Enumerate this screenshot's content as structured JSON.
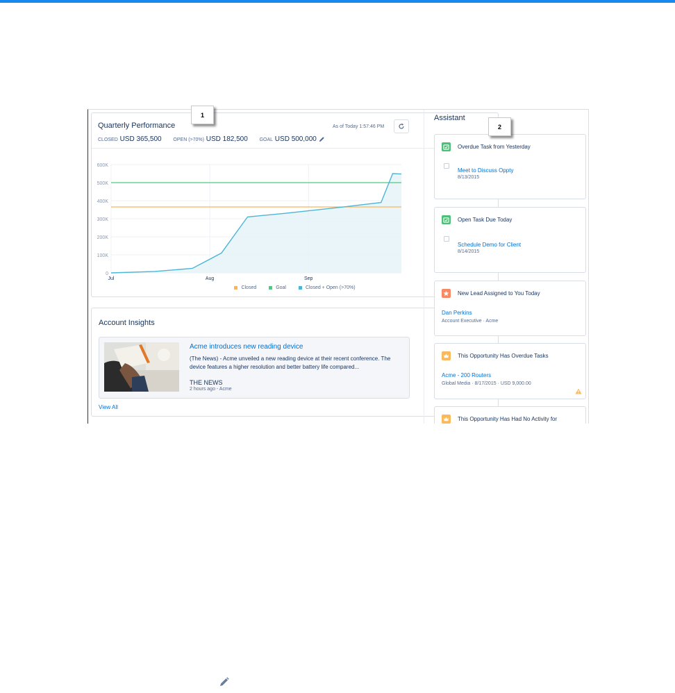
{
  "quarterly": {
    "title": "Quarterly Performance",
    "as_of": "As of Today 1:57:46 PM",
    "closed_label": "CLOSED",
    "closed_value": "USD 365,500",
    "open_label": "OPEN (>70%)",
    "open_value": "USD 182,500",
    "goal_label": "GOAL",
    "goal_value": "USD 500,000"
  },
  "callouts": {
    "one": "1",
    "two": "2"
  },
  "chart_data": {
    "type": "line",
    "x_labels": [
      "Jul",
      "Aug",
      "Sep"
    ],
    "y_ticks": [
      "0",
      "100K",
      "200K",
      "300K",
      "400K",
      "500K",
      "600K"
    ],
    "ylim": [
      0,
      600000
    ],
    "series": [
      {
        "name": "Closed",
        "color": "#f9b55b",
        "type": "line",
        "values": [
          365500
        ]
      },
      {
        "name": "Goal",
        "color": "#4bca81",
        "type": "line",
        "values": [
          500000
        ]
      },
      {
        "name": "Closed + Open (>70%)",
        "color": "#4bb5d6",
        "type": "area",
        "x": [
          0,
          0.15,
          0.28,
          0.38,
          0.47,
          0.6,
          0.8,
          0.93,
          0.97,
          1.0
        ],
        "values": [
          0,
          8000,
          25000,
          110000,
          310000,
          330000,
          365000,
          390000,
          550000,
          548000
        ]
      }
    ],
    "grid": true,
    "legend": "bottom"
  },
  "insights": {
    "title": "Account Insights",
    "news_title": "Acme introduces new reading device",
    "news_body": "(The News) - Acme unveiled a new reading device at their recent conference. The device features a higher resolution and better battery life compared...",
    "news_source": "THE NEWS",
    "news_time": "2 hours ago - Acme",
    "view_all": "View All"
  },
  "assistant": {
    "title": "Assistant",
    "cards": [
      {
        "heading": "Overdue Task from Yesterday",
        "link": "Meet to Discuss Oppty",
        "sub": "8/13/2015",
        "icon": "task-icon",
        "color": "#4bc076"
      },
      {
        "heading": "Open Task Due Today",
        "link": "Schedule Demo for Client",
        "sub": "8/14/2015",
        "icon": "task-icon",
        "color": "#4bc076"
      },
      {
        "heading": "New Lead Assigned to You Today",
        "link": "Dan Perkins",
        "sub": "Account Executive · Acme",
        "icon": "lead-icon",
        "color": "#f88962"
      },
      {
        "heading": "This Opportunity Has Overdue Tasks",
        "link": "Acme - 200 Routers",
        "sub": "Global Media · 8/17/2015 · USD 9,000.00",
        "icon": "opportunity-icon",
        "color": "#fcb95b"
      },
      {
        "heading": "This Opportunity Has Had No Activity for",
        "icon": "opportunity-icon",
        "color": "#fcb95b"
      }
    ]
  }
}
